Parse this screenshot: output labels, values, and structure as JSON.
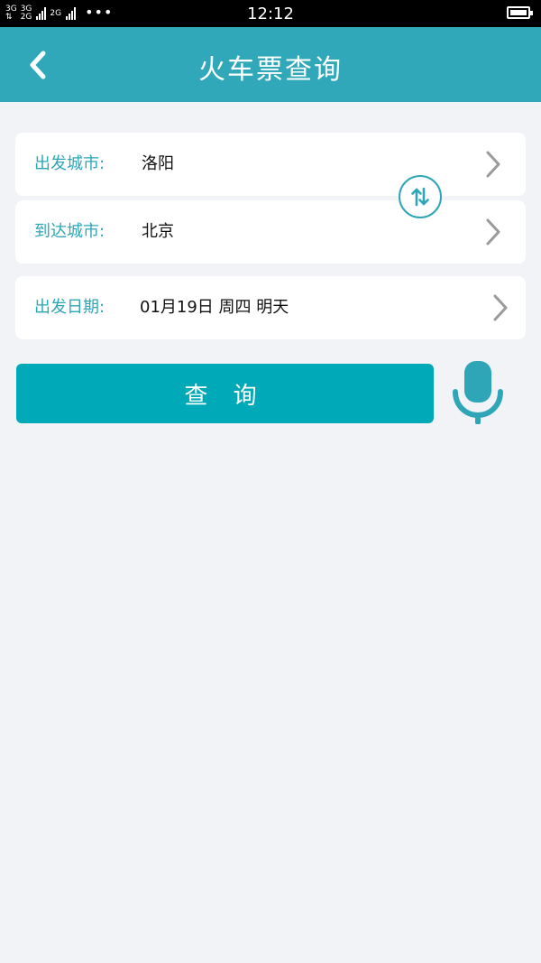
{
  "status_bar": {
    "sim1": [
      "3G",
      "⇅"
    ],
    "sim2": [
      "3G",
      "2G"
    ],
    "sim3": "2G",
    "dots": "•••",
    "time": "12:12"
  },
  "nav": {
    "title": "火车票查询"
  },
  "form": {
    "from": {
      "label": "出发城市:",
      "value": "洛阳"
    },
    "to": {
      "label": "到达城市:",
      "value": "北京"
    },
    "date": {
      "label": "出发日期:",
      "value": "01月19日 周四 明天"
    }
  },
  "actions": {
    "search_label": "查 询"
  },
  "icons": {
    "back": "chevron-left-icon",
    "swap": "swap-vertical-icon",
    "chevron": "chevron-right-icon",
    "mic": "microphone-icon",
    "battery": "battery-icon"
  },
  "colors": {
    "nav_bg": "#30a8b9",
    "accent": "#2ea6b7",
    "button_bg": "#00a9b8",
    "page_bg": "#f1f3f7"
  }
}
